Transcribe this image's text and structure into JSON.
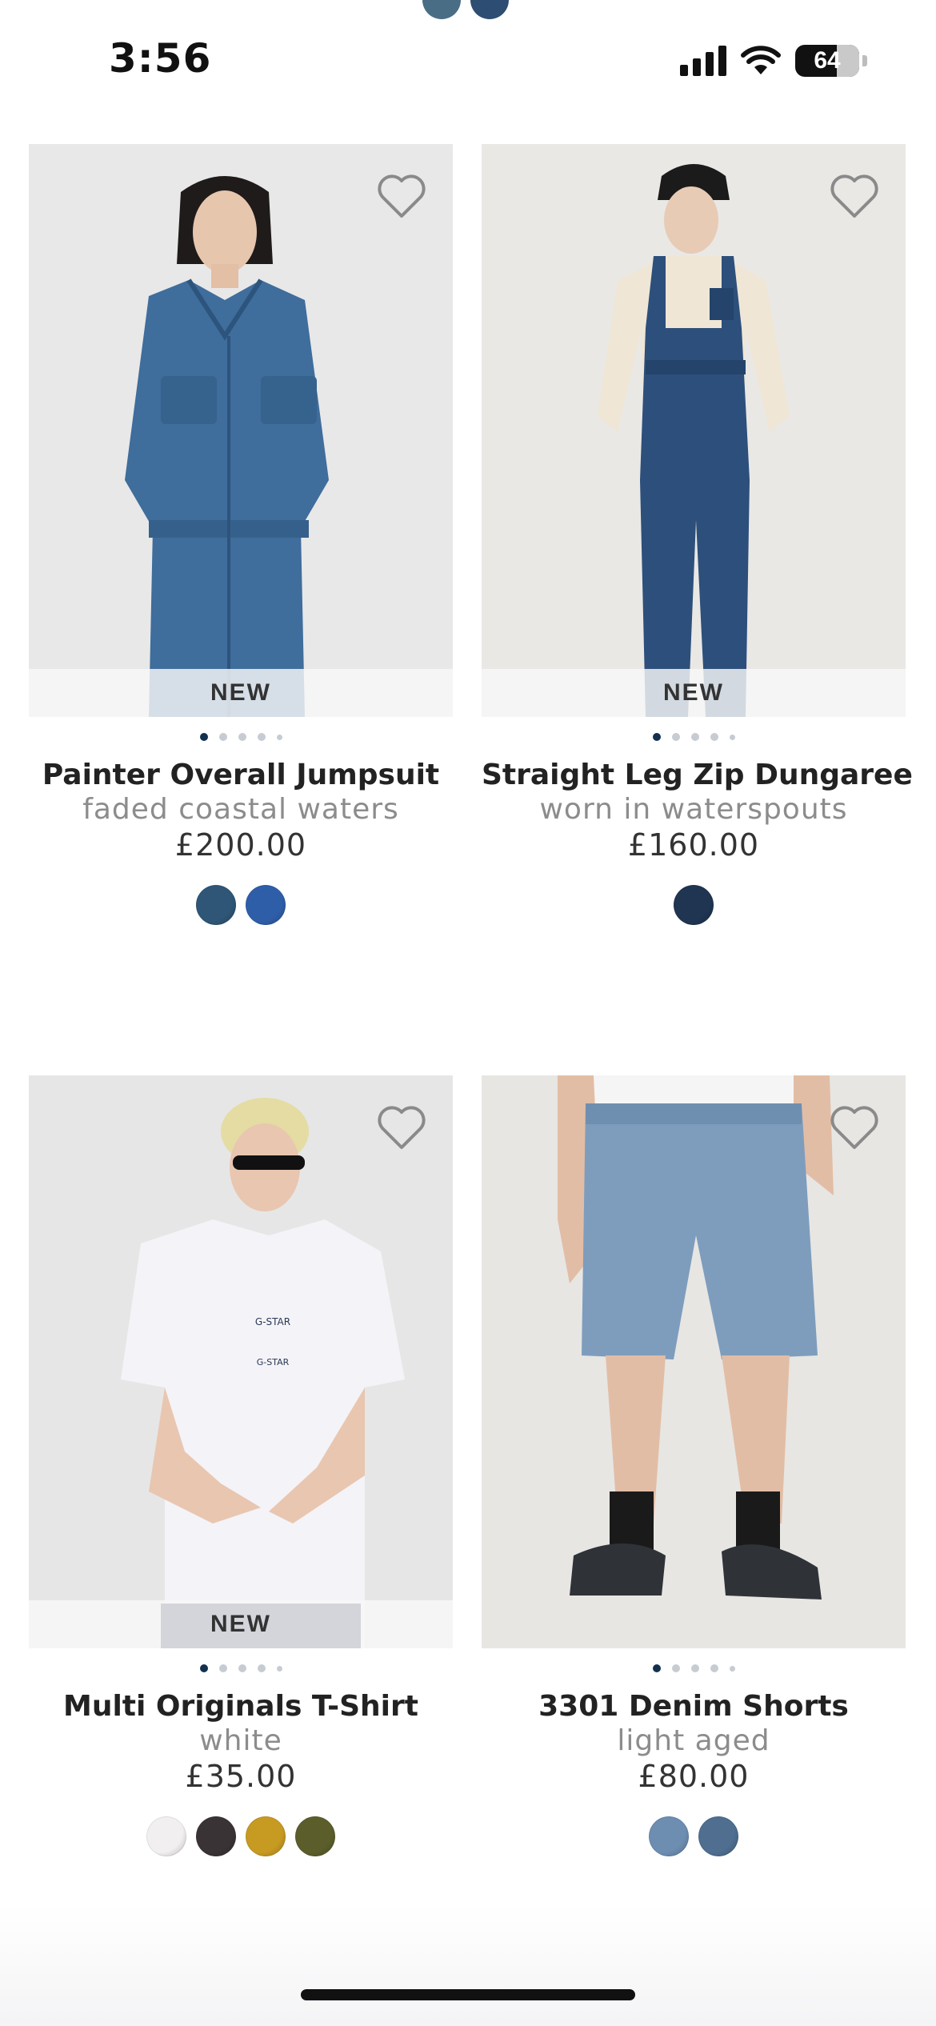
{
  "status_bar": {
    "time": "3:56",
    "battery": "64"
  },
  "top_peek_swatches": [
    "#4a6d86",
    "#2e4d72"
  ],
  "products": [
    {
      "name": "Painter Overall Jumpsuit",
      "color": "faded coastal waters",
      "price": "£200.00",
      "badge": "NEW",
      "image_bg": "#e8e8e8",
      "swatches": [
        "#2f5677",
        "#2f5ea9"
      ]
    },
    {
      "name": "Straight Leg Zip Dungaree",
      "color": "worn in waterspouts",
      "price": "£160.00",
      "badge": "NEW",
      "image_bg": "#e9e8e5",
      "swatches": [
        "#1f3552"
      ]
    },
    {
      "name": "Multi Originals T-Shirt",
      "color": "white",
      "price": "£35.00",
      "badge": "NEW",
      "image_bg": "#e6e6e6",
      "swatches": [
        "#f1eff0",
        "#3a3335",
        "#c79a22",
        "#5b5e2b"
      ]
    },
    {
      "name": "3301 Denim Shorts",
      "color": "light aged",
      "price": "£80.00",
      "badge": "",
      "image_bg": "#e7e6e3",
      "swatches": [
        "#6d8db1",
        "#4f6e90"
      ]
    }
  ],
  "icons": {
    "wishlist": "heart-outline-icon",
    "signal": "cellular-signal-icon",
    "wifi": "wifi-icon",
    "battery": "battery-icon"
  }
}
